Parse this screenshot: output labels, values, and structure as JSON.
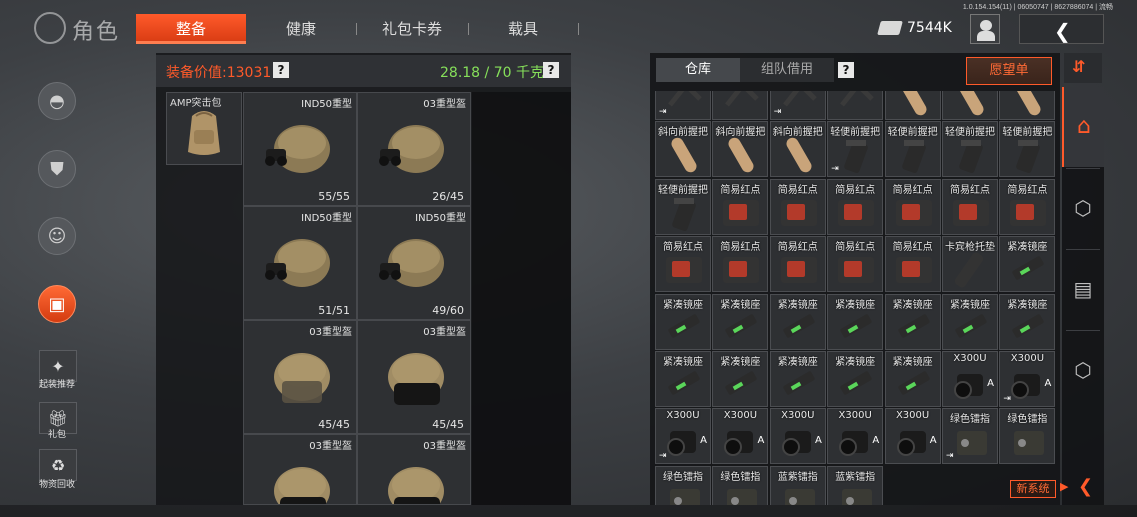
{
  "version": "1.0.154.154(11) | 06050747 | 8627886074 | 流畅",
  "page_title": "角色",
  "tabs": [
    {
      "label": "整备",
      "active": true
    },
    {
      "label": "健康",
      "active": false
    },
    {
      "label": "礼包卡券",
      "active": false
    },
    {
      "label": "载具",
      "active": false
    }
  ],
  "currency": {
    "value": "7544K",
    "icon": "money-icon"
  },
  "sidebar": {
    "round_buttons": [
      {
        "icon": "helmet-icon"
      },
      {
        "icon": "vest-icon"
      },
      {
        "icon": "face-icon"
      },
      {
        "icon": "briefcase-icon"
      }
    ],
    "square_buttons": [
      {
        "icon": "loadout-recommend-icon",
        "label": "起装推荐"
      },
      {
        "icon": "gift-icon",
        "label": "礼包"
      },
      {
        "icon": "recycle-icon",
        "label": "物资回收"
      }
    ]
  },
  "equipment": {
    "value_label": "装备价值:13031",
    "weight_label": "28.18 / 70 千克",
    "help": "?",
    "backpack": {
      "name": "AMP突击包"
    },
    "helmets": [
      {
        "name": "IND50重型",
        "durability": "55/55",
        "style": "nvg"
      },
      {
        "name": "03重型盔",
        "durability": "26/45",
        "style": "nvg"
      },
      {
        "name": "IND50重型",
        "durability": "51/51",
        "style": "nvg"
      },
      {
        "name": "IND50重型",
        "durability": "49/60",
        "style": "nvg"
      },
      {
        "name": "03重型盔",
        "durability": "45/45",
        "style": "visor-open"
      },
      {
        "name": "03重型盔",
        "durability": "45/45",
        "style": "visor-dark"
      },
      {
        "name": "03重型盔",
        "durability": "",
        "style": "visor-dark"
      },
      {
        "name": "03重型盔",
        "durability": "",
        "style": "visor-dark"
      }
    ]
  },
  "inventory": {
    "tabs": [
      {
        "label": "仓库",
        "active": true
      },
      {
        "label": "组队借用",
        "active": false
      }
    ],
    "help": "?",
    "wishlist_label": "愿望单",
    "rows": [
      [
        {
          "name": "",
          "kind": "angled",
          "marker": "⇥"
        },
        {
          "name": "",
          "kind": "angled",
          "marker": ""
        },
        {
          "name": "",
          "kind": "angled",
          "marker": "⇥"
        },
        {
          "name": "",
          "kind": "angled",
          "marker": ""
        },
        {
          "name": "",
          "kind": "grip",
          "marker": ""
        },
        {
          "name": "",
          "kind": "grip",
          "marker": ""
        },
        {
          "name": "",
          "kind": "grip",
          "marker": ""
        }
      ],
      [
        {
          "name": "斜向前握把",
          "kind": "grip",
          "marker": ""
        },
        {
          "name": "斜向前握把",
          "kind": "grip",
          "marker": ""
        },
        {
          "name": "斜向前握把",
          "kind": "grip",
          "marker": ""
        },
        {
          "name": "轻便前握把",
          "kind": "lightgrip",
          "marker": "⇥"
        },
        {
          "name": "轻便前握把",
          "kind": "lightgrip",
          "marker": ""
        },
        {
          "name": "轻便前握把",
          "kind": "lightgrip",
          "marker": ""
        },
        {
          "name": "轻便前握把",
          "kind": "lightgrip",
          "marker": ""
        }
      ],
      [
        {
          "name": "轻便前握把",
          "kind": "lightgrip",
          "marker": ""
        },
        {
          "name": "简易红点",
          "kind": "reddot",
          "marker": ""
        },
        {
          "name": "简易红点",
          "kind": "reddot",
          "marker": ""
        },
        {
          "name": "简易红点",
          "kind": "reddot",
          "marker": ""
        },
        {
          "name": "简易红点",
          "kind": "reddot",
          "marker": ""
        },
        {
          "name": "简易红点",
          "kind": "reddot",
          "marker": ""
        },
        {
          "name": "简易红点",
          "kind": "reddot",
          "marker": ""
        }
      ],
      [
        {
          "name": "简易红点",
          "kind": "reddot",
          "marker": ""
        },
        {
          "name": "简易红点",
          "kind": "reddot",
          "marker": ""
        },
        {
          "name": "简易红点",
          "kind": "reddot",
          "marker": ""
        },
        {
          "name": "简易红点",
          "kind": "reddot",
          "marker": ""
        },
        {
          "name": "简易红点",
          "kind": "reddot",
          "marker": ""
        },
        {
          "name": "卡宾枪托垫",
          "kind": "pad",
          "marker": ""
        },
        {
          "name": "紧凑镜座",
          "kind": "mount",
          "marker": ""
        }
      ],
      [
        {
          "name": "紧凑镜座",
          "kind": "mount",
          "marker": ""
        },
        {
          "name": "紧凑镜座",
          "kind": "mount",
          "marker": ""
        },
        {
          "name": "紧凑镜座",
          "kind": "mount",
          "marker": ""
        },
        {
          "name": "紧凑镜座",
          "kind": "mount",
          "marker": ""
        },
        {
          "name": "紧凑镜座",
          "kind": "mount",
          "marker": ""
        },
        {
          "name": "紧凑镜座",
          "kind": "mount",
          "marker": ""
        },
        {
          "name": "紧凑镜座",
          "kind": "mount",
          "marker": ""
        }
      ],
      [
        {
          "name": "紧凑镜座",
          "kind": "mount",
          "marker": ""
        },
        {
          "name": "紧凑镜座",
          "kind": "mount",
          "marker": ""
        },
        {
          "name": "紧凑镜座",
          "kind": "mount",
          "marker": ""
        },
        {
          "name": "紧凑镜座",
          "kind": "mount",
          "marker": ""
        },
        {
          "name": "紧凑镜座",
          "kind": "mount",
          "marker": ""
        },
        {
          "name": "X300U",
          "kind": "light",
          "marker": "",
          "badge": "A"
        },
        {
          "name": "X300U",
          "kind": "light",
          "marker": "⇥",
          "badge": "A"
        }
      ],
      [
        {
          "name": "X300U",
          "kind": "light",
          "marker": "⇥",
          "badge": "A"
        },
        {
          "name": "X300U",
          "kind": "light",
          "marker": "",
          "badge": "A"
        },
        {
          "name": "X300U",
          "kind": "light",
          "marker": "",
          "badge": "A"
        },
        {
          "name": "X300U",
          "kind": "light",
          "marker": "",
          "badge": "A"
        },
        {
          "name": "X300U",
          "kind": "light",
          "marker": "",
          "badge": "A"
        },
        {
          "name": "绿色镭指",
          "kind": "laser",
          "marker": "⇥"
        },
        {
          "name": "绿色镭指",
          "kind": "laser",
          "marker": ""
        }
      ],
      [
        {
          "name": "绿色镭指",
          "kind": "laser",
          "marker": ""
        },
        {
          "name": "绿色镭指",
          "kind": "laser",
          "marker": ""
        },
        {
          "name": "蓝紫镭指",
          "kind": "laser",
          "marker": ""
        },
        {
          "name": "蓝紫镭指",
          "kind": "laser",
          "marker": ""
        }
      ]
    ]
  },
  "category_rail": [
    {
      "icon": "home-icon",
      "active": true
    },
    {
      "icon": "box-icon",
      "active": false
    },
    {
      "icon": "ammo-box-icon",
      "active": false
    },
    {
      "icon": "box-icon",
      "active": false
    }
  ],
  "new_system_label": "新系统",
  "colors": {
    "accent": "#ff5a2a",
    "weight_green": "#86e05a"
  }
}
